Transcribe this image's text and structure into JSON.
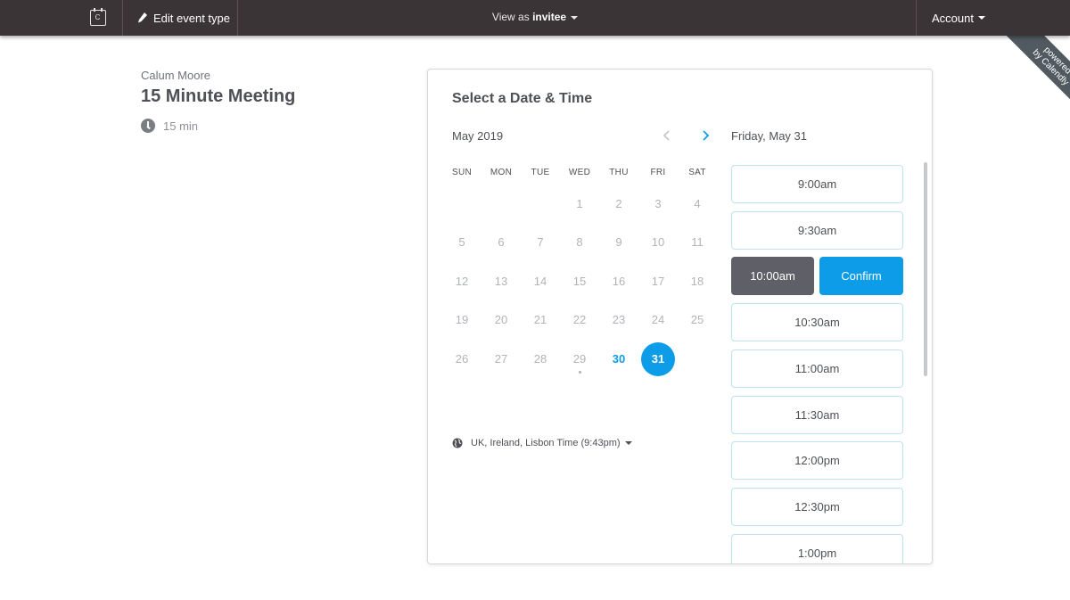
{
  "topbar": {
    "logo_letter": "C",
    "edit_label": "Edit event type",
    "view_prefix": "View as",
    "view_mode": "invitee",
    "account_label": "Account"
  },
  "ribbon": {
    "line1": "powered",
    "line2": "by Calendly"
  },
  "event": {
    "organizer": "Calum Moore",
    "title": "15 Minute Meeting",
    "duration": "15 min"
  },
  "booking": {
    "title": "Select a Date & Time",
    "month": "May 2019",
    "weekdays": [
      "SUN",
      "MON",
      "TUE",
      "WED",
      "THU",
      "FRI",
      "SAT"
    ],
    "days": [
      {
        "n": "1",
        "state": "off"
      },
      {
        "n": "2",
        "state": "off"
      },
      {
        "n": "3",
        "state": "off"
      },
      {
        "n": "4",
        "state": "off"
      },
      {
        "n": "5",
        "state": "off"
      },
      {
        "n": "6",
        "state": "off"
      },
      {
        "n": "7",
        "state": "off"
      },
      {
        "n": "8",
        "state": "off"
      },
      {
        "n": "9",
        "state": "off"
      },
      {
        "n": "10",
        "state": "off"
      },
      {
        "n": "11",
        "state": "off"
      },
      {
        "n": "12",
        "state": "off"
      },
      {
        "n": "13",
        "state": "off"
      },
      {
        "n": "14",
        "state": "off"
      },
      {
        "n": "15",
        "state": "off"
      },
      {
        "n": "16",
        "state": "off"
      },
      {
        "n": "17",
        "state": "off"
      },
      {
        "n": "18",
        "state": "off"
      },
      {
        "n": "19",
        "state": "off"
      },
      {
        "n": "20",
        "state": "off"
      },
      {
        "n": "21",
        "state": "off"
      },
      {
        "n": "22",
        "state": "off"
      },
      {
        "n": "23",
        "state": "off"
      },
      {
        "n": "24",
        "state": "off"
      },
      {
        "n": "25",
        "state": "off"
      },
      {
        "n": "26",
        "state": "off"
      },
      {
        "n": "27",
        "state": "off"
      },
      {
        "n": "28",
        "state": "off"
      },
      {
        "n": "29",
        "state": "today"
      },
      {
        "n": "30",
        "state": "available"
      },
      {
        "n": "31",
        "state": "selected"
      }
    ],
    "timezone": "UK, Ireland, Lisbon Time (9:43pm)",
    "selected_date_label": "Friday, May 31",
    "slots": [
      {
        "time": "9:00am",
        "selected": false
      },
      {
        "time": "9:30am",
        "selected": false
      },
      {
        "time": "10:00am",
        "selected": true
      },
      {
        "time": "10:30am",
        "selected": false
      },
      {
        "time": "11:00am",
        "selected": false
      },
      {
        "time": "11:30am",
        "selected": false
      },
      {
        "time": "12:00pm",
        "selected": false
      },
      {
        "time": "12:30pm",
        "selected": false
      },
      {
        "time": "1:00pm",
        "selected": false
      }
    ],
    "confirm_label": "Confirm"
  },
  "colors": {
    "topbar": "#3b3436",
    "accent": "#0d9ce8",
    "selected_slot": "#5f6067",
    "ribbon": "#505a60"
  }
}
